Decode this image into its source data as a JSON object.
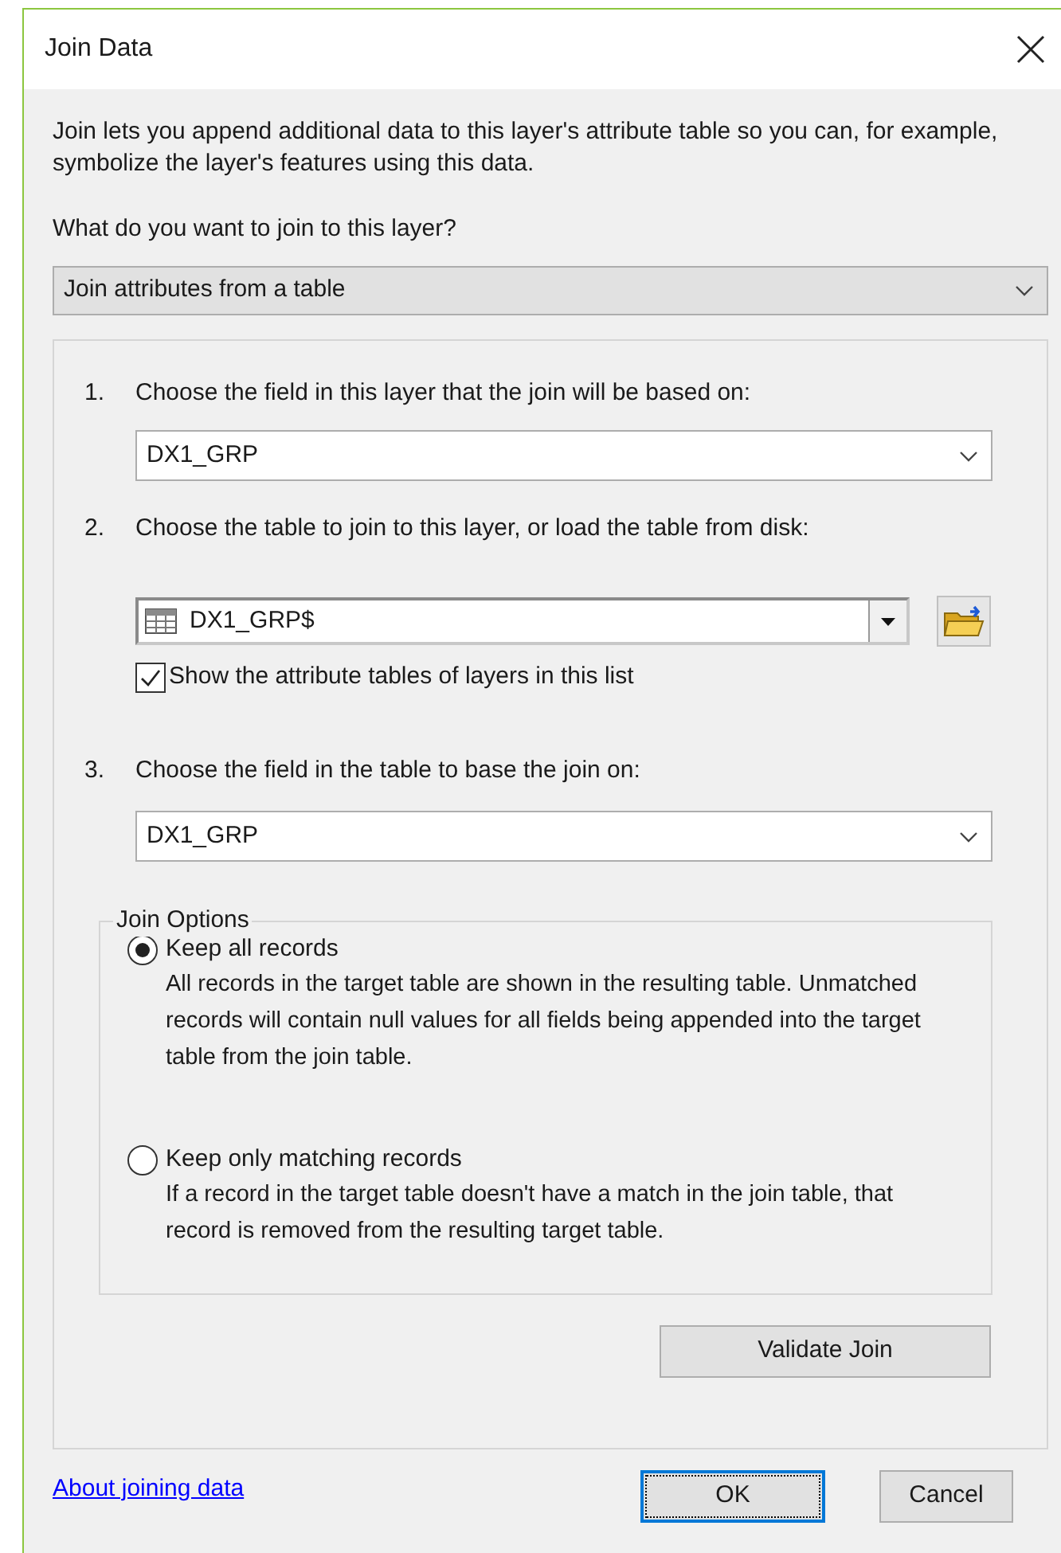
{
  "window": {
    "title": "Join Data"
  },
  "intro": "Join lets you append additional data to this layer's attribute table so you can, for example, symbolize the layer's features using this data.",
  "question": "What do you want to join to this layer?",
  "join_type": {
    "value": "Join attributes from a table"
  },
  "steps": [
    {
      "number": "1.",
      "label": "Choose the field in this layer that the join will be based on:",
      "kind": "field_combo",
      "value": "DX1_GRP"
    },
    {
      "number": "2.",
      "label": "Choose the table to join to this layer, or load the table from disk:",
      "kind": "table_combo",
      "value": "DX1_GRP$",
      "checkbox": {
        "label": "Show the attribute tables of layers in this list",
        "checked": true
      }
    },
    {
      "number": "3.",
      "label": "Choose the field in the table to base the join on:",
      "kind": "field_combo",
      "value": "DX1_GRP"
    }
  ],
  "join_options": {
    "legend": "Join Options",
    "options": [
      {
        "label": "Keep all records",
        "selected": true,
        "description": "All records in the target table are shown in the resulting table. Unmatched records will contain null values for all fields being appended into the target table from the join table."
      },
      {
        "label": "Keep only matching records",
        "selected": false,
        "description": "If a record in the target table doesn't have a match in the join table, that record is removed from the resulting target table."
      }
    ]
  },
  "validate_button": "Validate Join",
  "help_link": "About joining data",
  "buttons": [
    {
      "label": "OK",
      "default": true
    },
    {
      "label": "Cancel",
      "default": false
    }
  ]
}
